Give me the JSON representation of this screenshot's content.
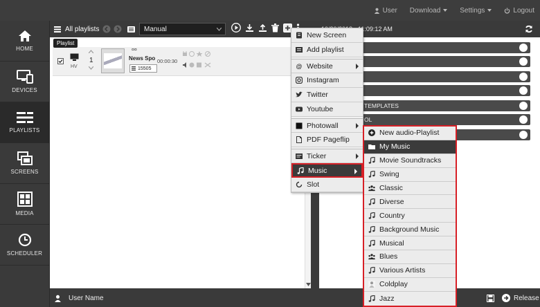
{
  "nav": {
    "user": "User",
    "download": "Download",
    "settings": "Settings",
    "logout": "Logout"
  },
  "sidebar": {
    "items": [
      {
        "label": "HOME"
      },
      {
        "label": "DEVICES"
      },
      {
        "label": "PLAYLISTS"
      },
      {
        "label": "SCREENS"
      },
      {
        "label": "MEDIA"
      },
      {
        "label": "SCHEDULER"
      }
    ]
  },
  "toolbar": {
    "title": "All playlists",
    "mode": "Manual",
    "tooltip": "Playlist"
  },
  "row": {
    "device": "HV",
    "order": "1",
    "name": "News Spo",
    "duration": "00:00:30",
    "code": "15505",
    "title_glyphs": "¤¤"
  },
  "right": {
    "datetime": "10/30/2018 - 11:09:12 AM",
    "acc_templates": "TEMPLATES",
    "acc_ol": "OL"
  },
  "bottom": {
    "username": "User Name",
    "release": "Release"
  },
  "menu": {
    "items": [
      {
        "label": "New Screen"
      },
      {
        "label": "Add playlist"
      },
      {
        "label": "Website"
      },
      {
        "label": "Instagram"
      },
      {
        "label": "Twitter"
      },
      {
        "label": "Youtube"
      },
      {
        "label": "Photowall"
      },
      {
        "label": "PDF Pageflip"
      },
      {
        "label": "Ticker"
      },
      {
        "label": "Music"
      },
      {
        "label": "Slot"
      }
    ]
  },
  "music": {
    "items": [
      {
        "label": "New audio-Playlist"
      },
      {
        "label": "My Music"
      },
      {
        "label": "Movie Soundtracks"
      },
      {
        "label": "Swing"
      },
      {
        "label": "Classic"
      },
      {
        "label": "Diverse"
      },
      {
        "label": "Country"
      },
      {
        "label": "Background Music"
      },
      {
        "label": "Musical"
      },
      {
        "label": "Blues"
      },
      {
        "label": "Various Artists"
      },
      {
        "label": "Coldplay"
      },
      {
        "label": "Jazz"
      }
    ]
  },
  "colors": {
    "highlight": "#d71f26",
    "dark": "#3a3a3a"
  }
}
